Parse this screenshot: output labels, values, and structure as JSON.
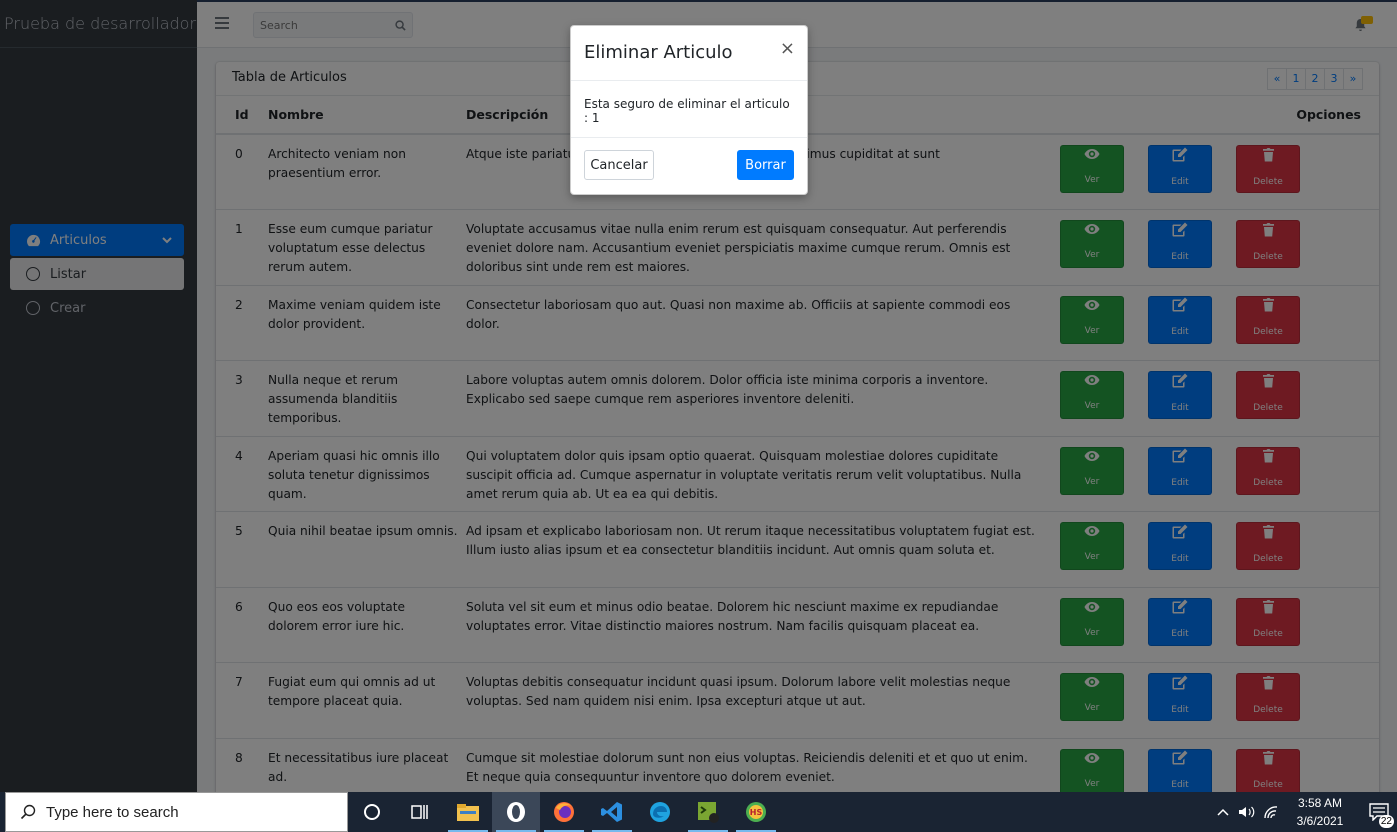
{
  "app": {
    "brand": "Prueba de desarrollador"
  },
  "sidebar": {
    "parent_label": "Articulos",
    "items": [
      {
        "label": "Listar",
        "active": true
      },
      {
        "label": "Crear",
        "active": false
      }
    ]
  },
  "topbar": {
    "search_placeholder": "Search"
  },
  "card": {
    "title": "Tabla de Articulos",
    "pagination": [
      "«",
      "1",
      "2",
      "3",
      "»"
    ]
  },
  "table": {
    "headers": {
      "id": "Id",
      "name": "Nombre",
      "desc": "Descripción",
      "options": "Opciones"
    },
    "action_labels": {
      "view": "Ver",
      "edit": "Edit",
      "delete": "Delete"
    },
    "rows": [
      {
        "id": "0",
        "name": "Architecto veniam non praesentium error.",
        "desc": "Atque iste pariatur dolorum ea iusto odio laborum. Possimus cupiditat at sunt"
      },
      {
        "id": "1",
        "name": "Esse eum cumque pariatur voluptatum esse delectus rerum autem.",
        "desc": "Voluptate accusamus vitae nulla enim rerum est quisquam consequatur. Aut perferendis eveniet dolore nam. Accusantium eveniet perspiciatis maxime cumque rerum. Omnis est doloribus sint unde rem est maiores."
      },
      {
        "id": "2",
        "name": "Maxime veniam quidem iste dolor provident.",
        "desc": "Consectetur laboriosam quo aut. Quasi non maxime ab. Officiis at sapiente commodi eos dolor."
      },
      {
        "id": "3",
        "name": "Nulla neque et rerum assumenda blanditiis temporibus.",
        "desc": "Labore voluptas autem omnis dolorem. Dolor officia iste minima corporis a inventore. Explicabo sed saepe cumque rem asperiores inventore deleniti."
      },
      {
        "id": "4",
        "name": "Aperiam quasi hic omnis illo soluta tenetur dignissimos quam.",
        "desc": "Qui voluptatem dolor quis ipsam optio quaerat. Quisquam molestiae dolores cupiditate suscipit officia ad. Cumque aspernatur in voluptate veritatis rerum velit voluptatibus. Nulla amet rerum quia ab. Ut ea ea qui debitis."
      },
      {
        "id": "5",
        "name": "Quia nihil beatae ipsum omnis.",
        "desc": "Ad ipsam et explicabo laboriosam non. Ut rerum itaque necessitatibus voluptatem fugiat est. Illum iusto alias ipsum et ea consectetur blanditiis incidunt. Aut omnis quam soluta et."
      },
      {
        "id": "6",
        "name": "Quo eos eos voluptate dolorem error iure hic.",
        "desc": "Soluta vel sit eum et minus odio beatae. Dolorem hic nesciunt maxime ex repudiandae voluptates error. Vitae distinctio maiores nostrum. Nam facilis quisquam placeat ea."
      },
      {
        "id": "7",
        "name": "Fugiat eum qui omnis ad ut tempore placeat quia.",
        "desc": "Voluptas debitis consequatur incidunt quasi ipsum. Dolorum labore velit molestias neque voluptas. Sed nam quidem nisi enim. Ipsa excepturi atque ut aut."
      },
      {
        "id": "8",
        "name": "Et necessitatibus iure placeat ad.",
        "desc": "Cumque sit molestiae dolorum sunt non eius voluptas. Reiciendis deleniti et et quo ut enim. Et neque quia consequuntur inventore quo dolorem eveniet."
      }
    ]
  },
  "modal": {
    "title": "Eliminar Articulo",
    "close": "×",
    "body": "Esta seguro de eliminar el articulo : 1",
    "cancel": "Cancelar",
    "confirm": "Borrar"
  },
  "taskbar": {
    "search_placeholder": "Type here to search",
    "time": "3:58 AM",
    "date": "3/6/2021",
    "notification_count": "22"
  },
  "colors": {
    "primary": "#007bff",
    "success": "#28a745",
    "danger": "#dc3545",
    "sidebar": "#343a40"
  }
}
